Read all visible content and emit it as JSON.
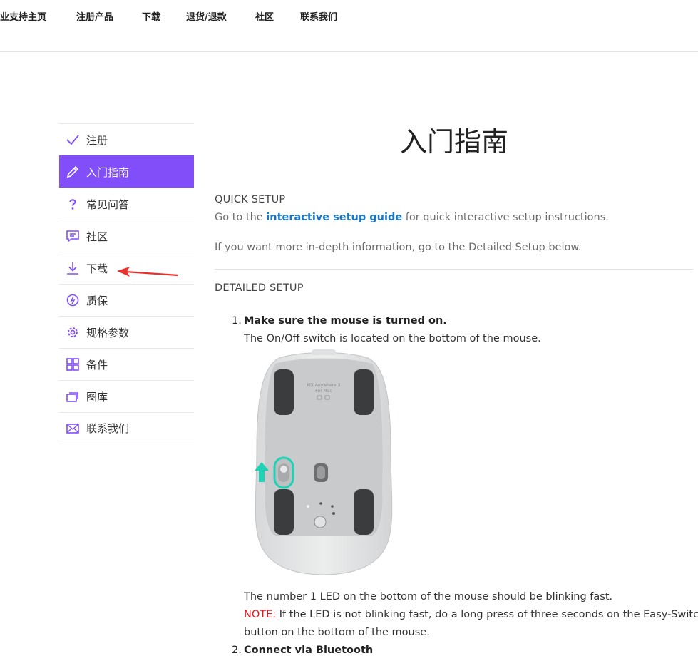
{
  "topnav": {
    "items": [
      "企业支持主页",
      "注册产品",
      "下载",
      "退货/退款",
      "社区",
      "联系我们"
    ]
  },
  "sidebar": {
    "items": [
      {
        "label": "注册",
        "icon": "check-icon",
        "active": false
      },
      {
        "label": "入门指南",
        "icon": "pencil-icon",
        "active": true
      },
      {
        "label": "常见问答",
        "icon": "question-icon",
        "active": false
      },
      {
        "label": "社区",
        "icon": "chat-icon",
        "active": false
      },
      {
        "label": "下载",
        "icon": "download-icon",
        "active": false
      },
      {
        "label": "质保",
        "icon": "warranty-icon",
        "active": false
      },
      {
        "label": "规格参数",
        "icon": "gear-icon",
        "active": false
      },
      {
        "label": "备件",
        "icon": "grid-icon",
        "active": false
      },
      {
        "label": "图库",
        "icon": "gallery-icon",
        "active": false
      },
      {
        "label": "联系我们",
        "icon": "mail-icon",
        "active": false
      }
    ],
    "accent": "#814efa"
  },
  "main": {
    "title": "入门指南",
    "quick_setup": {
      "heading": "QUICK SETUP",
      "line1_before": "Go to the ",
      "line1_link": "interactive setup guide",
      "line1_after": " for quick interactive setup instructions.",
      "line2": "If you want more in-depth information, go to the Detailed Setup below."
    },
    "detailed_setup": {
      "heading": "DETAILED SETUP",
      "steps": [
        {
          "num": "1.",
          "title": "Make sure the mouse is turned on.",
          "text": "The On/Off switch is located on the bottom of the mouse.",
          "after1": "The number 1 LED on the bottom of the mouse should be blinking fast.",
          "note_label": "NOTE:",
          "note_text": " If the LED is not blinking fast, do a long press of three seconds on the Easy-Switch",
          "note_text2": "button on the bottom of the mouse."
        },
        {
          "num": "2.",
          "title": "Connect via Bluetooth"
        }
      ]
    },
    "mouse_image": {
      "model_line1": "MX Anywhere 3",
      "model_line2": "For Mac"
    }
  },
  "colors": {
    "link": "#1977c9",
    "note": "#e0161b",
    "arrow": "#e8302c",
    "teal": "#1fd1b5"
  }
}
